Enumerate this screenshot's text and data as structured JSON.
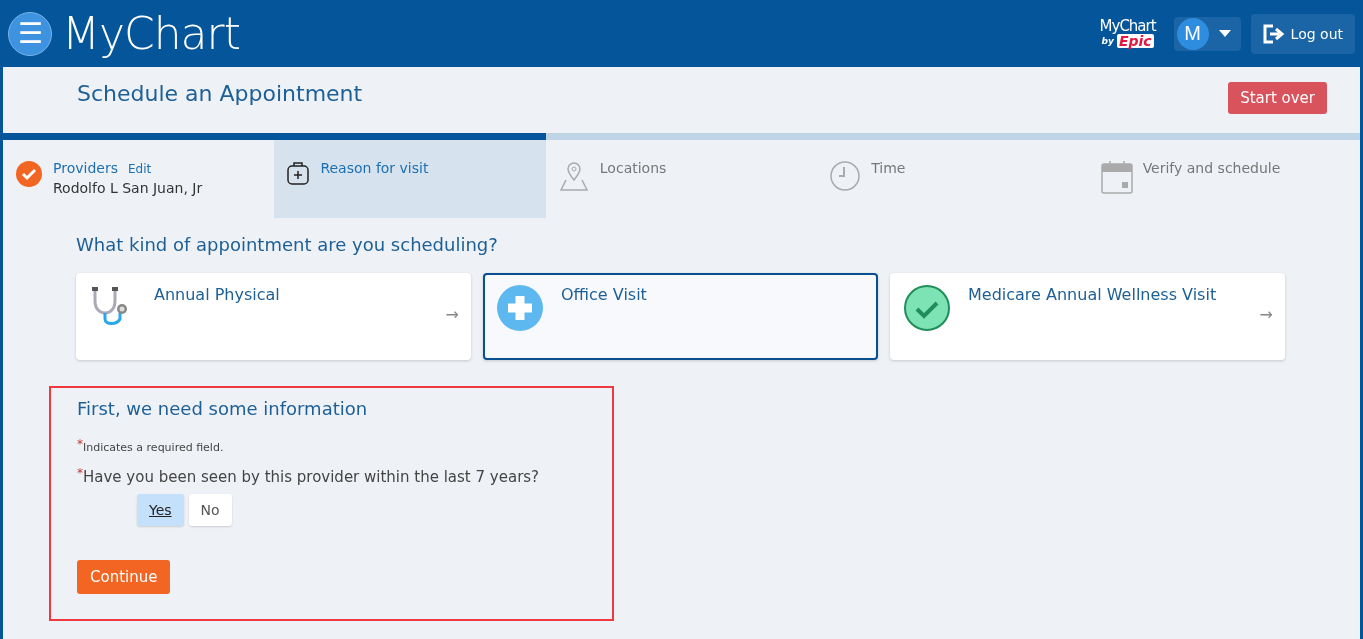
{
  "header": {
    "menu_label": "☰",
    "logo": "MyChart",
    "brand": {
      "name": "MyChart",
      "by": "by",
      "maker": "Epic"
    },
    "avatar": "M",
    "logout": "Log out"
  },
  "page": {
    "title": "Schedule an Appointment",
    "start_over": "Start over",
    "progress": {
      "level": 0.4
    }
  },
  "steps": [
    {
      "label": "Providers",
      "action": "Edit",
      "detail": "Rodolfo L San Juan, Jr",
      "completed": true,
      "selected": false
    },
    {
      "label": "Reason for visit",
      "completed": false,
      "selected": true
    },
    {
      "label": "Locations",
      "completed": false,
      "selected": false
    },
    {
      "label": "Time",
      "completed": false,
      "selected": false
    },
    {
      "label": "Verify and schedule",
      "completed": false,
      "selected": false
    }
  ],
  "question": "What kind of appointment are you scheduling?",
  "visit_types": [
    {
      "label": "Annual Physical",
      "selected": false,
      "arrow": "→"
    },
    {
      "label": "Office Visit",
      "selected": true
    },
    {
      "label": "Medicare Annual Wellness Visit",
      "selected": false,
      "arrow": "→"
    }
  ],
  "info": {
    "heading": "First, we need some information",
    "required_mark": "*",
    "required_note": "Indicates a required field.",
    "question_mark": "*",
    "question": "Have you been seen by this provider within the last 7 years?",
    "options": [
      {
        "label": "Yes",
        "selected": true
      },
      {
        "label": "No",
        "selected": false
      }
    ],
    "continue": "Continue"
  }
}
